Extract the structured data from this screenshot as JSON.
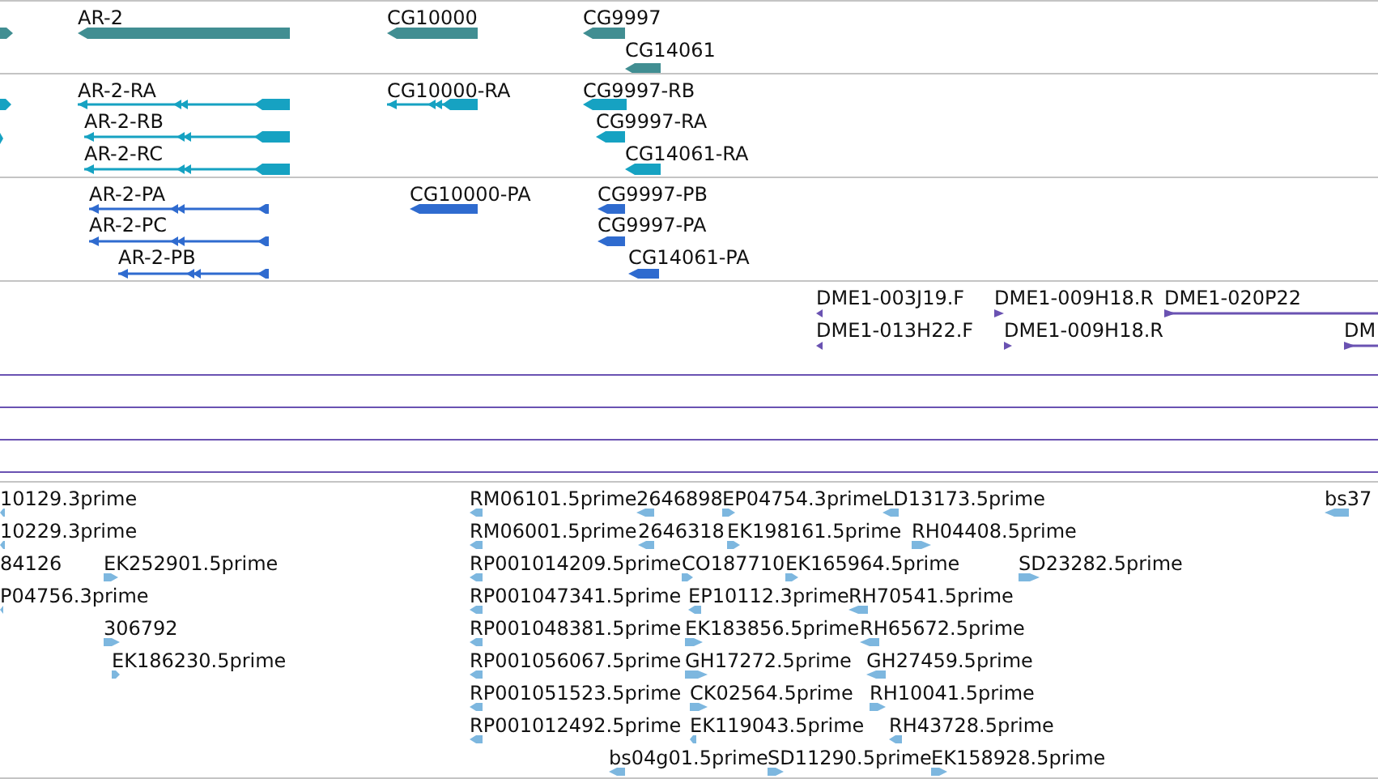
{
  "tracks": [
    {
      "kind": "gene",
      "color": "#418e92",
      "features": [
        {
          "reverse": false
        },
        {
          "label": "AR-2",
          "reverse": true
        },
        {
          "label": "CG10000",
          "reverse": true
        },
        {
          "label": "CG9997",
          "reverse": true
        },
        {
          "label": "CG14061",
          "reverse": true
        }
      ]
    },
    {
      "kind": "transcript",
      "color": "#16a2c2",
      "features": [
        {
          "reverse": false
        },
        {
          "reverse": false
        },
        {
          "label": "AR-2-RA",
          "reverse": true
        },
        {
          "label": "AR-2-RB",
          "reverse": true
        },
        {
          "label": "AR-2-RC",
          "reverse": true
        },
        {
          "label": "CG10000-RA",
          "reverse": true
        },
        {
          "label": "CG9997-RB",
          "reverse": true
        },
        {
          "label": "CG9997-RA",
          "reverse": true
        },
        {
          "label": "CG14061-RA",
          "reverse": true
        }
      ]
    },
    {
      "kind": "protein",
      "color": "#2f6bcf",
      "features": [
        {
          "label": "AR-2-PA",
          "reverse": true
        },
        {
          "label": "AR-2-PC",
          "reverse": true
        },
        {
          "label": "AR-2-PB",
          "reverse": true
        },
        {
          "label": "CG10000-PA",
          "reverse": true
        },
        {
          "label": "CG9997-PB",
          "reverse": true
        },
        {
          "label": "CG9997-PA",
          "reverse": true
        },
        {
          "label": "CG14061-PA",
          "reverse": true
        }
      ]
    },
    {
      "kind": "bac",
      "color": "#6a52b2",
      "features": [
        {
          "label": "DME1-003J19.F",
          "reverse": true
        },
        {
          "label": "DME1-009H18.R",
          "reverse": false
        },
        {
          "label": "DME1-020P22",
          "reverse": false
        },
        {
          "label": "DME1-013H22.F",
          "reverse": true
        },
        {
          "label": "DME1-009H18.R",
          "reverse": false
        },
        {
          "label": "DM",
          "reverse": false
        }
      ]
    },
    {
      "kind": "est",
      "color": "#7db7df",
      "features": [
        {
          "label": "10129.3prime",
          "reverse": true
        },
        {
          "label": "RM06101.5prime",
          "reverse": true
        },
        {
          "label": "2646898",
          "reverse": true
        },
        {
          "label": "EP04754.3prime",
          "reverse": false
        },
        {
          "label": "LD13173.5prime",
          "reverse": true
        },
        {
          "label": "bs37",
          "reverse": true
        },
        {
          "label": "10229.3prime",
          "reverse": true
        },
        {
          "label": "RM06001.5prime",
          "reverse": true
        },
        {
          "label": "2646318",
          "reverse": true
        },
        {
          "label": "EK198161.5prime",
          "reverse": false
        },
        {
          "label": "RH04408.5prime",
          "reverse": false
        },
        {
          "label": "84126"
        },
        {
          "label": "EK252901.5prime",
          "reverse": false
        },
        {
          "label": "RP001014209.5prime",
          "reverse": true
        },
        {
          "label": "CO187710",
          "reverse": false
        },
        {
          "label": "EK165964.5prime",
          "reverse": false
        },
        {
          "label": "SD23282.5prime",
          "reverse": false
        },
        {
          "label": "P04756.3prime",
          "reverse": true
        },
        {
          "label": "RP001047341.5prime",
          "reverse": true
        },
        {
          "label": "EP10112.3prime",
          "reverse": true
        },
        {
          "label": "RH70541.5prime",
          "reverse": true
        },
        {
          "label": "306792",
          "reverse": false
        },
        {
          "label": "RP001048381.5prime",
          "reverse": true
        },
        {
          "label": "EK183856.5prime",
          "reverse": false
        },
        {
          "label": "RH65672.5prime",
          "reverse": true
        },
        {
          "label": "EK186230.5prime",
          "reverse": false
        },
        {
          "label": "RP001056067.5prime",
          "reverse": true
        },
        {
          "label": "GH17272.5prime",
          "reverse": false
        },
        {
          "label": "GH27459.5prime",
          "reverse": true
        },
        {
          "label": "RP001051523.5prime",
          "reverse": true
        },
        {
          "label": "CK02564.5prime",
          "reverse": false
        },
        {
          "label": "RH10041.5prime",
          "reverse": false
        },
        {
          "label": "RP001012492.5prime",
          "reverse": true
        },
        {
          "label": "EK119043.5prime",
          "reverse": true
        },
        {
          "label": "RH43728.5prime",
          "reverse": true
        },
        {
          "label": "bs04g01.5prime",
          "reverse": true
        },
        {
          "label": "SD11290.5prime",
          "reverse": false
        },
        {
          "label": "EK158928.5prime",
          "reverse": false
        }
      ]
    }
  ]
}
